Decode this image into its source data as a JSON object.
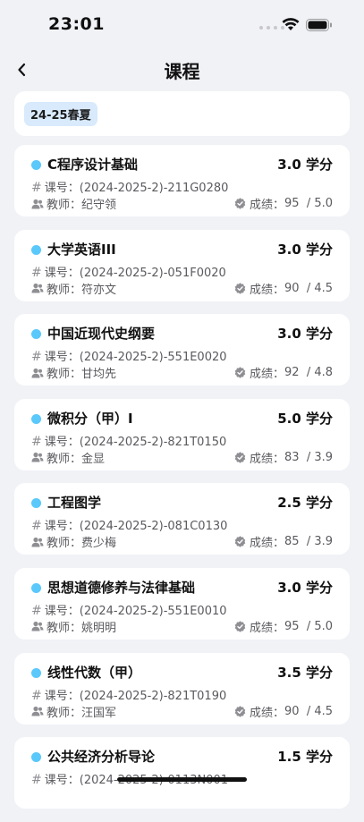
{
  "status": {
    "time": "23:01"
  },
  "nav": {
    "title": "课程"
  },
  "term": {
    "label": "24-25春夏"
  },
  "labels": {
    "code": "课号：",
    "teacher": "教师：",
    "grade": "成绩："
  },
  "courses": [
    {
      "name": "C程序设计基础",
      "credit": "3.0 学分",
      "code": "(2024-2025-2)-211G0280",
      "teacher": "纪守领",
      "score": "95",
      "gpa": "/ 5.0"
    },
    {
      "name": "大学英语III",
      "credit": "3.0 学分",
      "code": "(2024-2025-2)-051F0020",
      "teacher": "符亦文",
      "score": "90",
      "gpa": "/ 4.5"
    },
    {
      "name": "中国近现代史纲要",
      "credit": "3.0 学分",
      "code": "(2024-2025-2)-551E0020",
      "teacher": "甘均先",
      "score": "92",
      "gpa": "/ 4.8"
    },
    {
      "name": "微积分（甲）I",
      "credit": "5.0 学分",
      "code": "(2024-2025-2)-821T0150",
      "teacher": "金显",
      "score": "83",
      "gpa": "/ 3.9"
    },
    {
      "name": "工程图学",
      "credit": "2.5 学分",
      "code": "(2024-2025-2)-081C0130",
      "teacher": "费少梅",
      "score": "85",
      "gpa": "/ 3.9"
    },
    {
      "name": "思想道德修养与法律基础",
      "credit": "3.0 学分",
      "code": "(2024-2025-2)-551E0010",
      "teacher": "姚明明",
      "score": "95",
      "gpa": "/ 5.0"
    },
    {
      "name": "线性代数（甲）",
      "credit": "3.5 学分",
      "code": "(2024-2025-2)-821T0190",
      "teacher": "汪国军",
      "score": "90",
      "gpa": "/ 4.5"
    },
    {
      "name": "公共经济分析导论",
      "credit": "1.5 学分",
      "code": "(2024-2025-2)-0113N001",
      "teacher": "",
      "score": "",
      "gpa": ""
    }
  ]
}
